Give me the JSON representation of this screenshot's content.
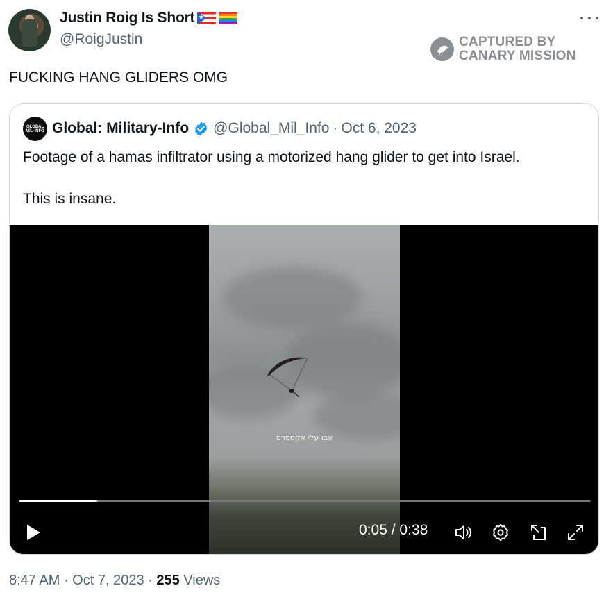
{
  "author": {
    "name": "Justin Roig Is Short",
    "flags": [
      "puerto-rico-flag",
      "rainbow-flag"
    ],
    "handle": "@RoigJustin"
  },
  "watermark": {
    "icon": "canary-bird-icon",
    "line1": "CAPTURED BY",
    "line2": "CANARY MISSION"
  },
  "tweet": {
    "text": "FUCKING HANG GLIDERS OMG"
  },
  "quoted": {
    "avatar_text": "GLOBAL MIL-INFO",
    "name": "Global: Military-Info",
    "verified": true,
    "handle": "@Global_Mil_Info",
    "separator": "·",
    "date": "Oct 6, 2023",
    "body": "Footage of a hamas infiltrator using a motorized hang glider to get into Israel.\n\nThis is insane."
  },
  "video": {
    "subtitle": "אבו עלי אקספרס",
    "current_time": "0:05",
    "duration": "0:38",
    "time_display": "0:05 / 0:38",
    "progress_fraction": 0.137,
    "controls": [
      "play-icon",
      "volume-icon",
      "settings-icon",
      "pop-out-icon",
      "fullscreen-icon"
    ]
  },
  "meta": {
    "time": "8:47 AM",
    "date": "Oct 7, 2023",
    "views_count": "255",
    "views_label": "Views"
  },
  "colors": {
    "text": "#0f1419",
    "secondary": "#536471",
    "verified": "#1d9bf0",
    "border": "#cfd9de",
    "watermark": "#8b8f94"
  }
}
